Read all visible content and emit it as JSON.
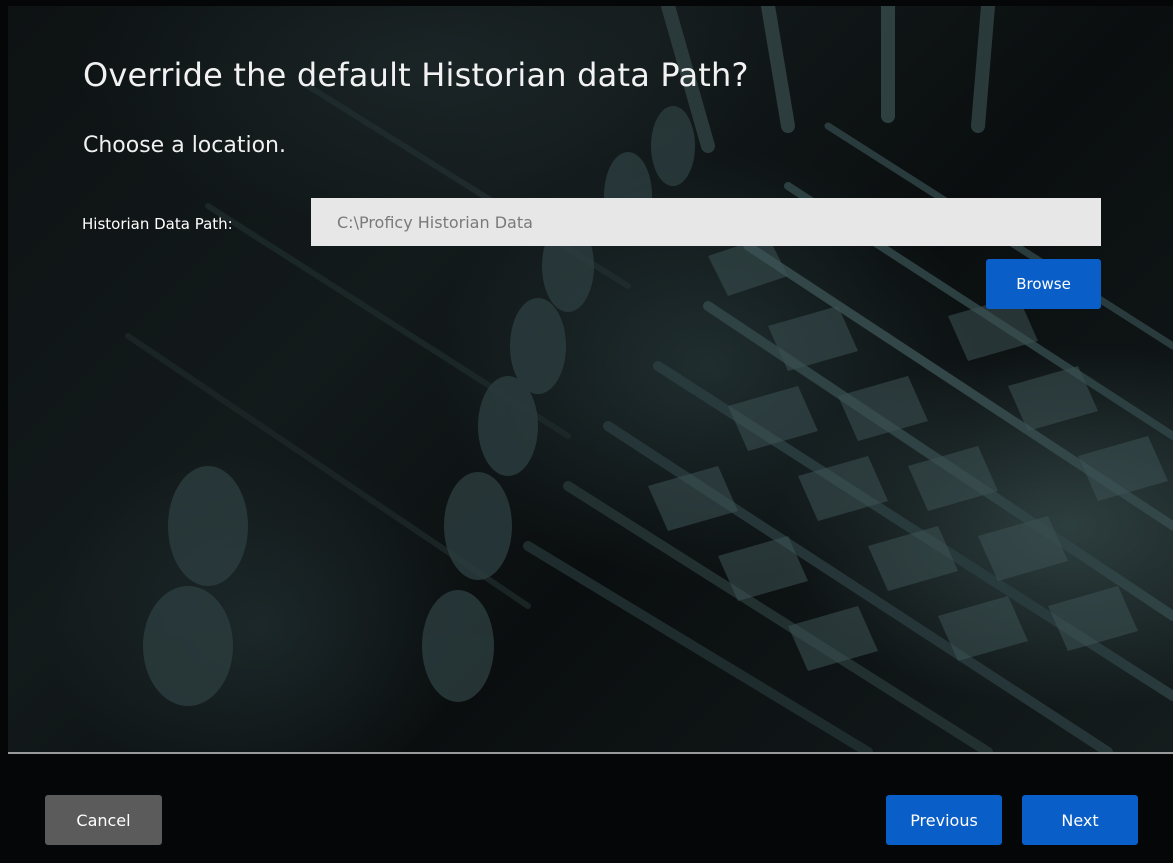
{
  "dialog": {
    "title": "Override the default Historian data Path?",
    "subtitle": "Choose a location."
  },
  "form": {
    "data_path_label": "Historian Data Path:",
    "data_path_value": "C:\\Proficy Historian Data",
    "browse_label": "Browse"
  },
  "footer": {
    "cancel_label": "Cancel",
    "previous_label": "Previous",
    "next_label": "Next"
  },
  "colors": {
    "primary_button": "#0a5ec7",
    "secondary_button": "#5b5b5b",
    "input_background": "#e7e7e7",
    "window_background": "#050607"
  }
}
